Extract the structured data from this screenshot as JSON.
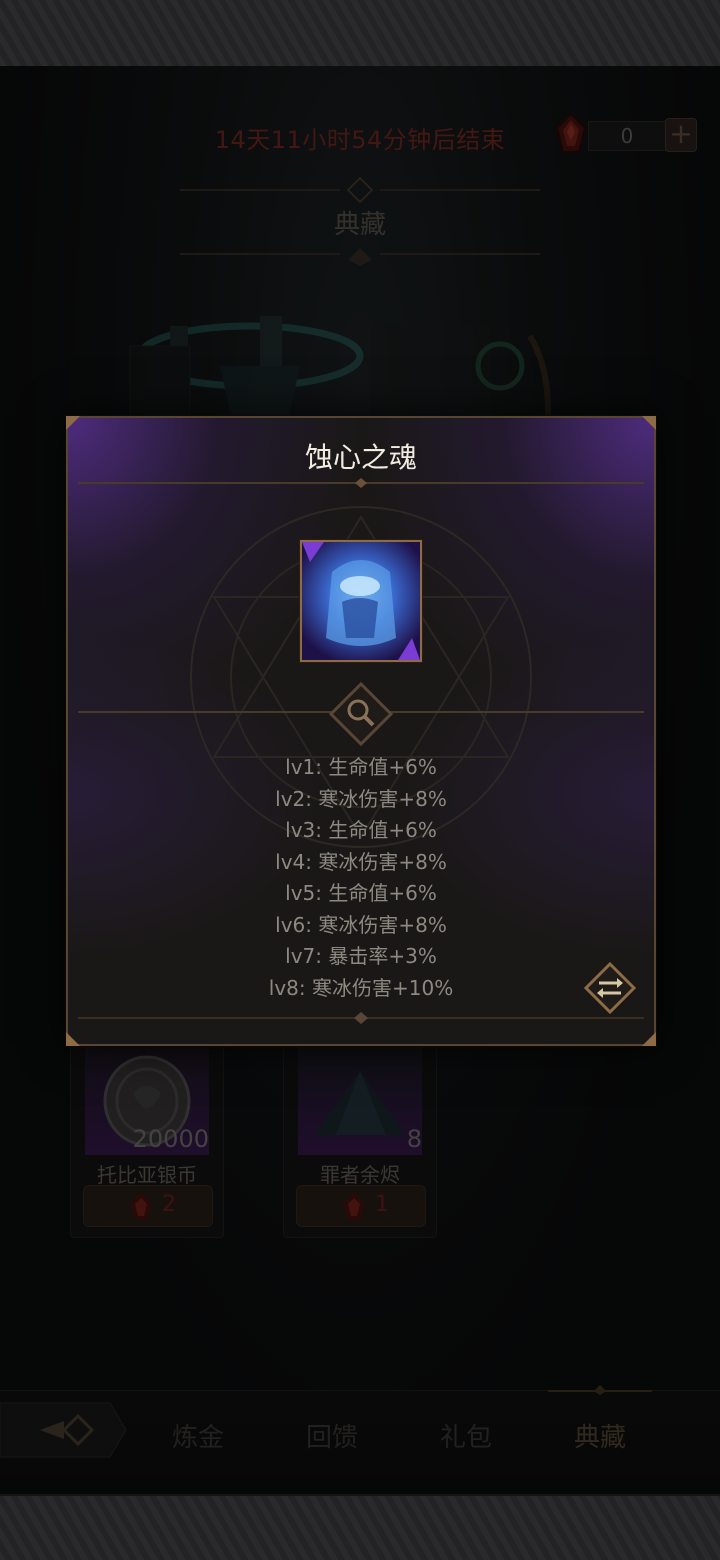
{
  "event": {
    "countdown": "14天11小时54分钟后结束",
    "currency_icon": "red-crystal-icon",
    "currency_amount": "0",
    "add_label": "+",
    "section_title": "典藏"
  },
  "popup": {
    "title": "蚀心之魂",
    "item_icon": "ice-soul-icon",
    "zoom_icon": "magnifier-icon",
    "switch_icon": "swap-arrows-icon",
    "stats": [
      "lv1: 生命值+6%",
      "lv2: 寒冰伤害+8%",
      "lv3: 生命值+6%",
      "lv4: 寒冰伤害+8%",
      "lv5: 生命值+6%",
      "lv6: 寒冰伤害+8%",
      "lv7: 暴击率+3%",
      "lv8: 寒冰伤害+10%"
    ]
  },
  "items": [
    {
      "name": "托比亚银币",
      "quantity": "20000",
      "price": "2",
      "icon": "silver-coin-icon"
    },
    {
      "name": "罪者余烬",
      "quantity": "8",
      "price": "1",
      "icon": "dark-ash-pile-icon"
    }
  ],
  "nav": {
    "back_icon": "back-arrow-icon",
    "tabs": [
      "炼金",
      "回馈",
      "礼包",
      "典藏"
    ],
    "active_tab": "典藏"
  },
  "colors": {
    "countdown": "#7a2a22",
    "popup_title": "#f2ece0",
    "stats_text": "#8d8880",
    "purple_glow": "#7a3cd2",
    "gold_frame": "#8c6b46"
  }
}
